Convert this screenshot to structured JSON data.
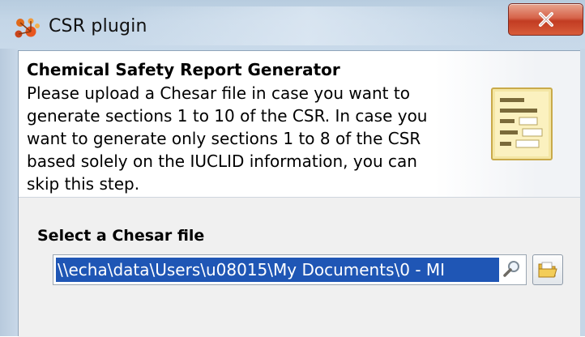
{
  "window": {
    "title": "CSR plugin",
    "close_icon": "close-x-icon",
    "app_icon": "csr-plugin-icon"
  },
  "header": {
    "title": "Chemical Safety Report Generator",
    "description": "Please upload a Chesar file in case you want to generate sections 1 to 10 of the CSR. In case you want to generate only sections 1 to 8 of the CSR based solely on the IUCLID information, you can skip this step.",
    "icon": "document-list-icon"
  },
  "form": {
    "label": "Select a Chesar file",
    "file_path": "\\\\echa\\data\\Users\\u08015\\My Documents\\0 - MI",
    "search_icon": "magnifier-icon",
    "browse_icon": "folder-icon"
  },
  "colors": {
    "close_button": "#d0533a",
    "selection": "#1f56b5",
    "title_bar": "#c4d6e7"
  }
}
